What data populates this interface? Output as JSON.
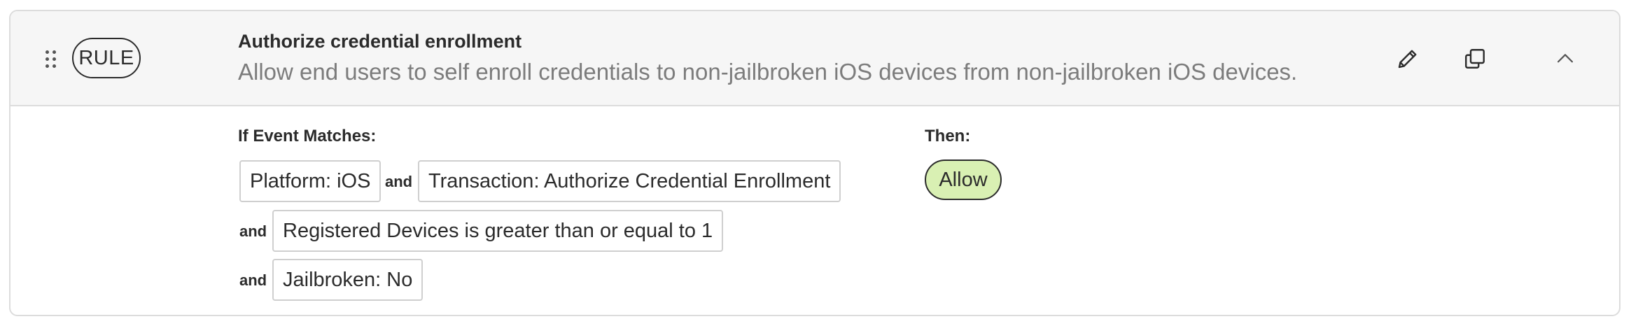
{
  "rule": {
    "badge": "RULE",
    "title": "Authorize credential enrollment",
    "description": "Allow end users to self enroll credentials to non-jailbroken iOS devices from non-jailbroken iOS devices."
  },
  "actions": {
    "edit_icon": "pencil-icon",
    "copy_icon": "copy-icon",
    "collapse_icon": "chevron-up-icon"
  },
  "conditions": {
    "label": "If Event Matches:",
    "conjunction": "and",
    "items": [
      "Platform: iOS",
      "Transaction: Authorize Credential Enrollment",
      "Registered Devices is greater than or equal to 1",
      "Jailbroken: No"
    ]
  },
  "outcome": {
    "label": "Then:",
    "action": "Allow",
    "action_color": "#d9f0b3"
  }
}
